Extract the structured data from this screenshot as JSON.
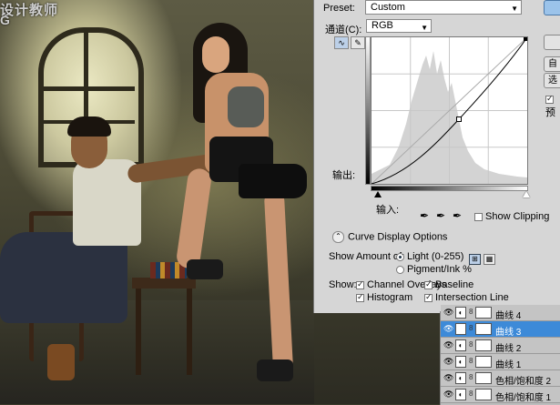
{
  "watermark": {
    "line1": "设计教师",
    "line2": "G"
  },
  "dialog": {
    "preset_label": "Preset:",
    "preset_value": "Custom",
    "channel_label": "通道(C):",
    "channel_value": "RGB",
    "output_label": "输出:",
    "input_label": "输入:",
    "show_clipping": "Show Clipping",
    "curve_display_options": "Curve Display Options",
    "show_amount_label": "Show Amount of:",
    "light_option": "Light  (0-255)",
    "pigment_option": "Pigment/Ink %",
    "show_label": "Show:",
    "channel_overlays": "Channel Overlays",
    "baseline": "Baseline",
    "histogram": "Histogram",
    "intersection_line": "Intersection Line",
    "side_buttons": [
      "",
      "",
      "自",
      "选",
      "预"
    ]
  },
  "layers": [
    {
      "name": "曲线 4",
      "selected": false,
      "thumb": "◐"
    },
    {
      "name": "曲线 3",
      "selected": true,
      "thumb": "◐"
    },
    {
      "name": "曲线 2",
      "selected": false,
      "thumb": "◐"
    },
    {
      "name": "曲线 1",
      "selected": false,
      "thumb": "◐"
    },
    {
      "name": "色相/饱和度 2",
      "selected": false,
      "thumb": "◐"
    },
    {
      "name": "色相/饱和度 1",
      "selected": false,
      "thumb": "◐"
    }
  ],
  "colors": {
    "selected_layer": "#3d8ad8",
    "dialog_bg": "#d6d6d6"
  }
}
